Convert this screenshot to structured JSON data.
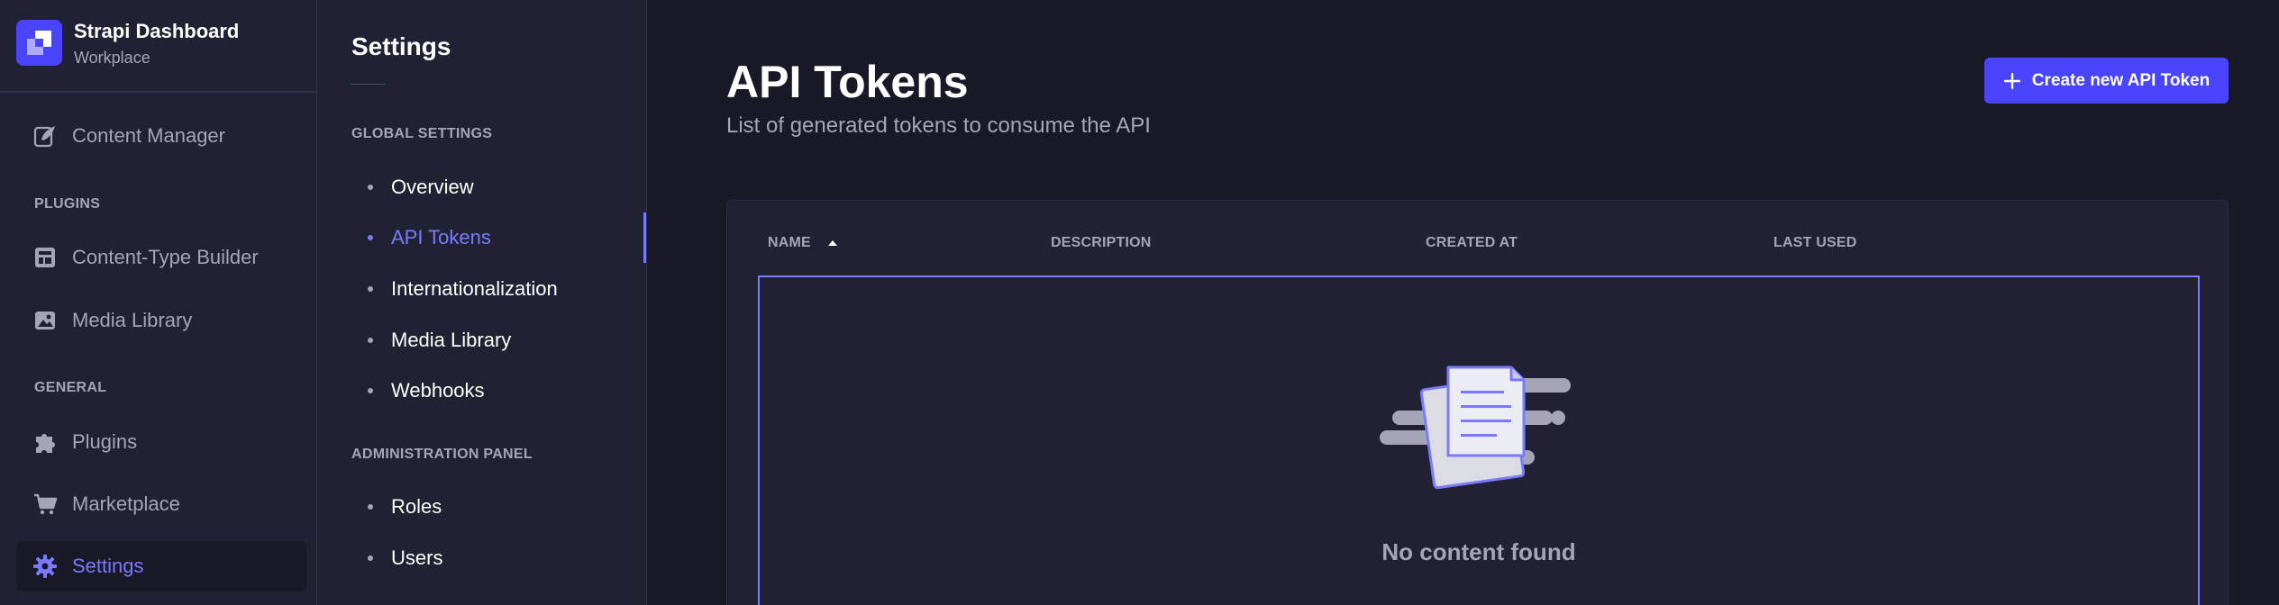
{
  "brand": {
    "title": "Strapi Dashboard",
    "subtitle": "Workplace"
  },
  "mainnav": {
    "top_items": [
      {
        "label": "Content Manager",
        "icon": "feather-icon"
      }
    ],
    "plugins_section": "PLUGINS",
    "plugins_items": [
      {
        "label": "Content-Type Builder",
        "icon": "layout-icon"
      },
      {
        "label": "Media Library",
        "icon": "image-icon"
      }
    ],
    "general_section": "GENERAL",
    "general_items": [
      {
        "label": "Plugins",
        "icon": "puzzle-icon"
      },
      {
        "label": "Marketplace",
        "icon": "cart-icon"
      },
      {
        "label": "Settings",
        "icon": "gear-icon",
        "active": true
      }
    ]
  },
  "subnav": {
    "title": "Settings",
    "global_section": "GLOBAL SETTINGS",
    "global_items": [
      {
        "label": "Overview"
      },
      {
        "label": "API Tokens",
        "active": true
      },
      {
        "label": "Internationalization"
      },
      {
        "label": "Media Library"
      },
      {
        "label": "Webhooks"
      }
    ],
    "admin_section": "ADMINISTRATION PANEL",
    "admin_items": [
      {
        "label": "Roles"
      },
      {
        "label": "Users"
      }
    ]
  },
  "page": {
    "title": "API Tokens",
    "subtitle": "List of generated tokens to consume the API",
    "create_button": "Create new API Token"
  },
  "table": {
    "columns": [
      "NAME",
      "DESCRIPTION",
      "CREATED AT",
      "LAST USED"
    ],
    "empty_message": "No content found"
  },
  "colors": {
    "accent": "#4945ff",
    "accent_text": "#7b79ff",
    "background": "#181826",
    "panel": "#212134",
    "muted_text": "#a5a5ba"
  }
}
